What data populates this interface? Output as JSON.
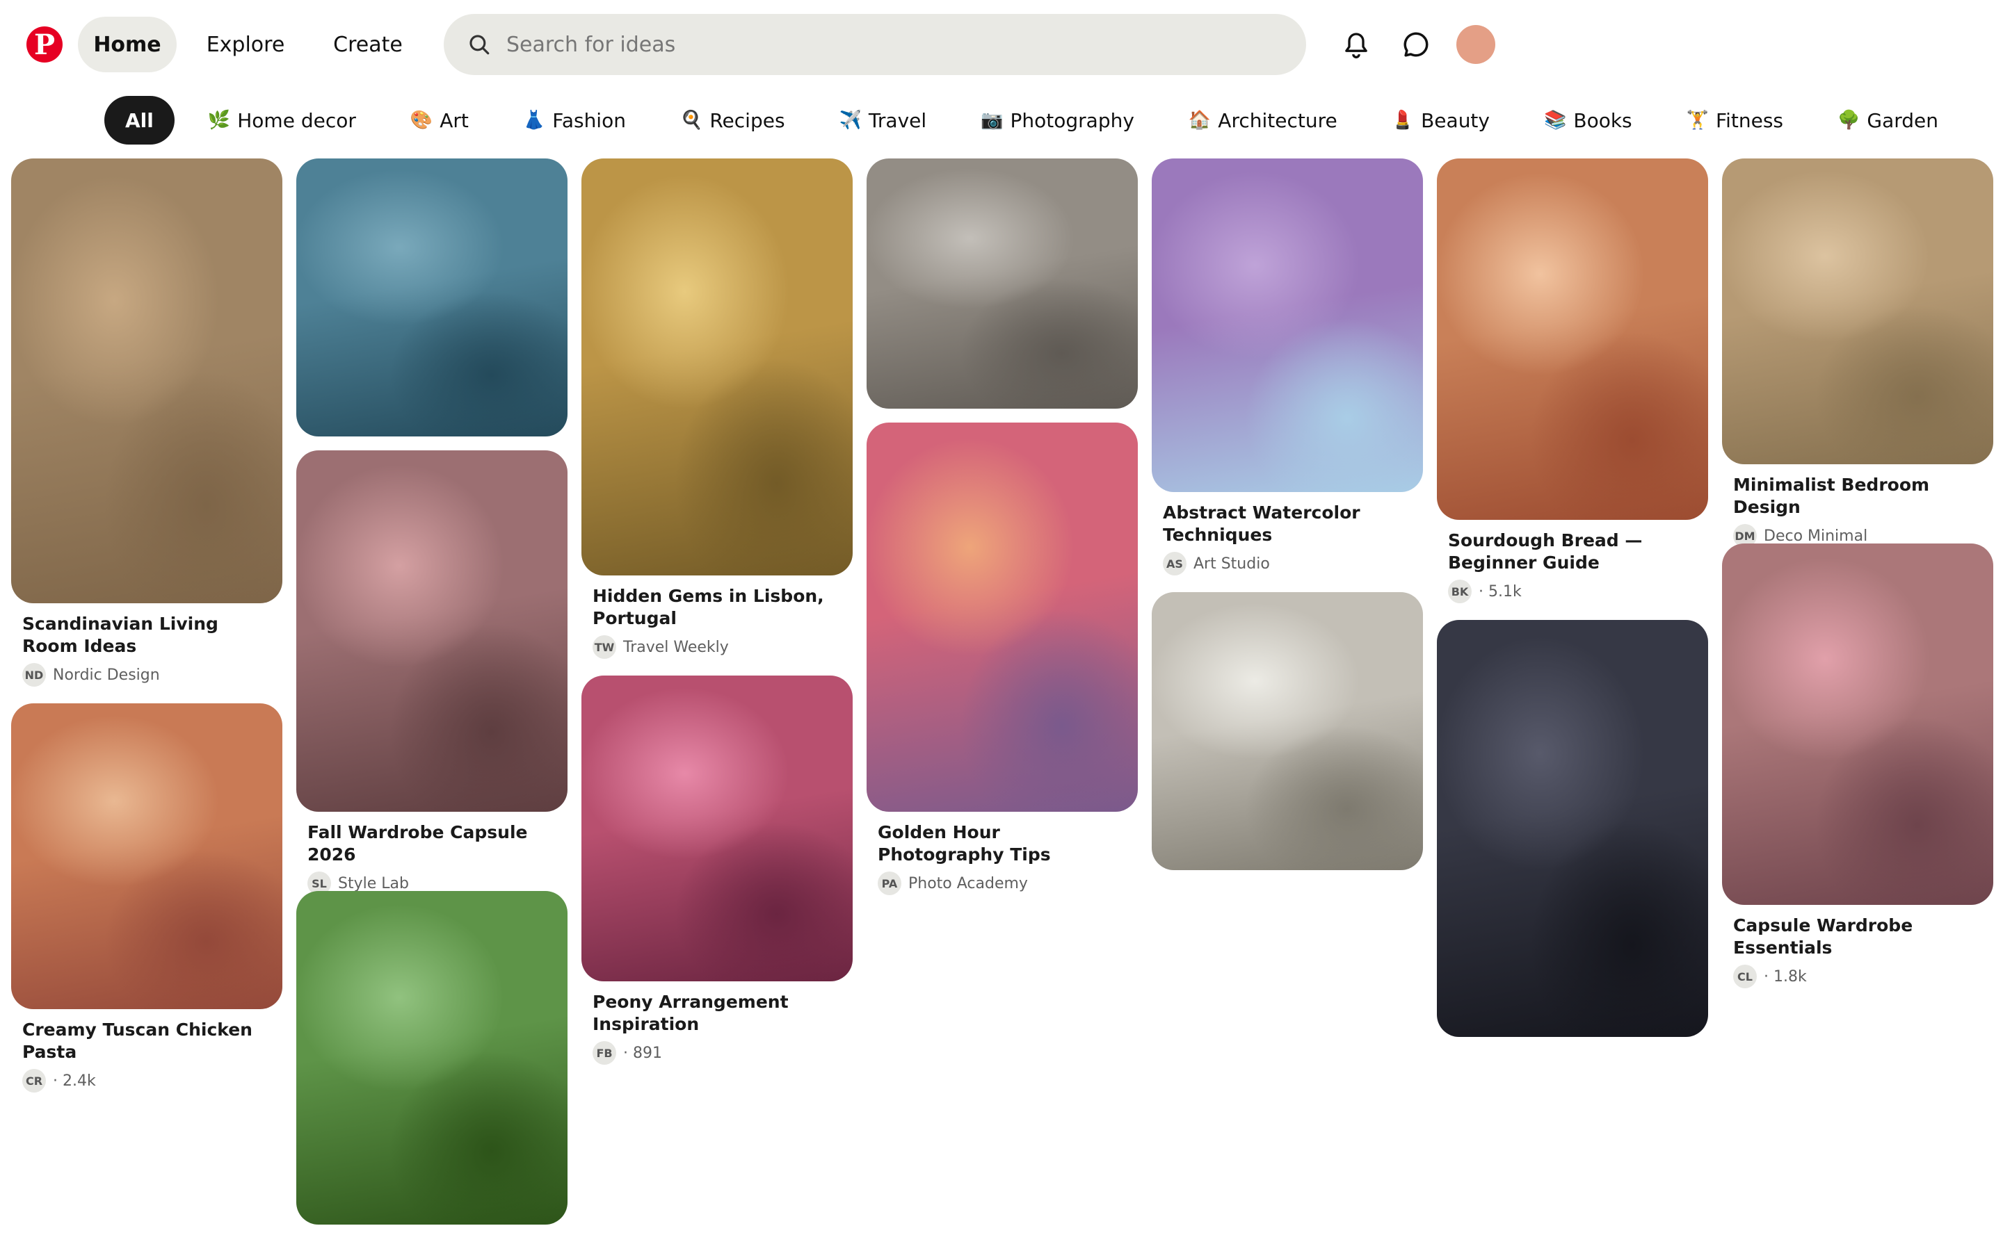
{
  "header": {
    "logo_letter": "P",
    "nav": [
      {
        "label": "Home",
        "active": true
      },
      {
        "label": "Explore",
        "active": false
      },
      {
        "label": "Create",
        "active": false
      }
    ],
    "search_placeholder": "Search for ideas",
    "icons": [
      "search-icon",
      "bell-icon",
      "message-icon"
    ],
    "avatar_color": "#e49f86"
  },
  "categories": [
    {
      "emoji": "",
      "label": "All",
      "active": true
    },
    {
      "emoji": "🌿",
      "label": "Home decor"
    },
    {
      "emoji": "🎨",
      "label": "Art"
    },
    {
      "emoji": "👗",
      "label": "Fashion"
    },
    {
      "emoji": "🍳",
      "label": "Recipes"
    },
    {
      "emoji": "✈️",
      "label": "Travel"
    },
    {
      "emoji": "📷",
      "label": "Photography"
    },
    {
      "emoji": "🏠",
      "label": "Architecture"
    },
    {
      "emoji": "💄",
      "label": "Beauty"
    },
    {
      "emoji": "📚",
      "label": "Books"
    },
    {
      "emoji": "🏋️",
      "label": "Fitness"
    },
    {
      "emoji": "🌳",
      "label": "Garden"
    }
  ],
  "pins": [
    {
      "title": "Scandinavian Living Room Ideas",
      "initials": "ND",
      "meta": "Nordic Design",
      "colors": [
        "#c7a882",
        "#a08564",
        "#7e6548"
      ]
    },
    {
      "title": "Creamy Tuscan Chicken Pasta",
      "initials": "CR",
      "meta": "· 2.4k",
      "colors": [
        "#e9b892",
        "#c97a55",
        "#94493a"
      ]
    },
    {
      "title": "",
      "initials": "",
      "meta": "",
      "colors": [
        "#7aa9bb",
        "#4e8196",
        "#244a5b"
      ]
    },
    {
      "title": "Fall Wardrobe Capsule 2026",
      "initials": "SL",
      "meta": "Style Lab",
      "colors": [
        "#d4a0a2",
        "#9c6f72",
        "#5e3e40"
      ]
    },
    {
      "title": "",
      "initials": "",
      "meta": "",
      "colors": [
        "#91c27f",
        "#5e9448",
        "#2d5419"
      ]
    },
    {
      "title": "Hidden Gems in Lisbon, Portugal",
      "initials": "TW",
      "meta": "Travel Weekly",
      "colors": [
        "#e8ca7e",
        "#bc9547",
        "#735b27"
      ]
    },
    {
      "title": "Peony Arrangement Inspiration",
      "initials": "FB",
      "meta": "· 891",
      "colors": [
        "#e789a8",
        "#b8506f",
        "#6b2541"
      ]
    },
    {
      "title": "",
      "initials": "",
      "meta": "",
      "colors": [
        "#c3bfb9",
        "#938d85",
        "#5f5a54"
      ]
    },
    {
      "title": "Golden Hour Photography Tips",
      "initials": "PA",
      "meta": "Photo Academy",
      "colors": [
        "#eea57a",
        "#d46479",
        "#7a5a8c"
      ]
    },
    {
      "title": "Abstract Watercolor Techniques",
      "initials": "AS",
      "meta": "Art Studio",
      "colors": [
        "#bfa3d8",
        "#9b79bc",
        "#a9cde6"
      ]
    },
    {
      "title": "",
      "initials": "",
      "meta": "",
      "colors": [
        "#ecebe5",
        "#c3bfb6",
        "#7e7a6f"
      ]
    },
    {
      "title": "Sourdough Bread — Beginner Guide",
      "initials": "BK",
      "meta": "· 5.1k",
      "colors": [
        "#f1c39f",
        "#c98058",
        "#9c4c31"
      ]
    },
    {
      "title": "",
      "initials": "",
      "meta": "",
      "colors": [
        "#585a6b",
        "#363845",
        "#15161d"
      ]
    },
    {
      "title": "Minimalist Bedroom Design",
      "initials": "DM",
      "meta": "Deco Minimal",
      "colors": [
        "#dcc3a0",
        "#b69a74",
        "#85704f"
      ]
    },
    {
      "title": "Capsule Wardrobe Essentials",
      "initials": "CL",
      "meta": "· 1.8k",
      "colors": [
        "#e1a0aa",
        "#ab7779",
        "#6e444c"
      ]
    }
  ]
}
